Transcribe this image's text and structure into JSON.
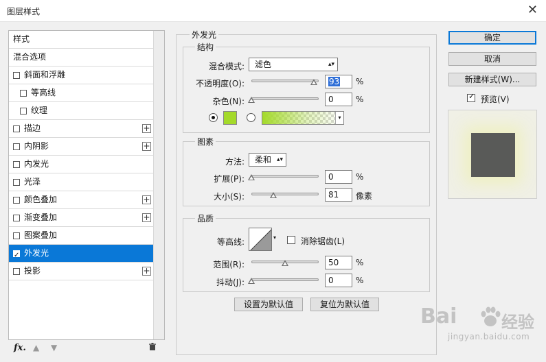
{
  "window": {
    "title": "图层样式"
  },
  "sidebar": {
    "items": [
      {
        "label": "样式",
        "kind": "head",
        "checkbox": false,
        "plus": false,
        "checked": false,
        "selected": false
      },
      {
        "label": "混合选项",
        "kind": "head",
        "checkbox": false,
        "plus": false,
        "checked": false,
        "selected": false
      },
      {
        "label": "斜面和浮雕",
        "kind": "top",
        "checkbox": true,
        "plus": false,
        "checked": false,
        "selected": false
      },
      {
        "label": "等高线",
        "kind": "sub",
        "checkbox": true,
        "plus": false,
        "checked": false,
        "selected": false
      },
      {
        "label": "纹理",
        "kind": "sub",
        "checkbox": true,
        "plus": false,
        "checked": false,
        "selected": false
      },
      {
        "label": "描边",
        "kind": "top",
        "checkbox": true,
        "plus": true,
        "checked": false,
        "selected": false
      },
      {
        "label": "内阴影",
        "kind": "top",
        "checkbox": true,
        "plus": true,
        "checked": false,
        "selected": false
      },
      {
        "label": "内发光",
        "kind": "top",
        "checkbox": true,
        "plus": false,
        "checked": false,
        "selected": false
      },
      {
        "label": "光泽",
        "kind": "top",
        "checkbox": true,
        "plus": false,
        "checked": false,
        "selected": false
      },
      {
        "label": "颜色叠加",
        "kind": "top",
        "checkbox": true,
        "plus": true,
        "checked": false,
        "selected": false
      },
      {
        "label": "渐变叠加",
        "kind": "top",
        "checkbox": true,
        "plus": true,
        "checked": false,
        "selected": false
      },
      {
        "label": "图案叠加",
        "kind": "top",
        "checkbox": true,
        "plus": false,
        "checked": false,
        "selected": false
      },
      {
        "label": "外发光",
        "kind": "top",
        "checkbox": true,
        "plus": false,
        "checked": true,
        "selected": true
      },
      {
        "label": "投影",
        "kind": "top",
        "checkbox": true,
        "plus": true,
        "checked": false,
        "selected": false
      }
    ],
    "bottom": {
      "fx": "fx",
      "fx_dot": "."
    }
  },
  "panel": {
    "title": "外发光",
    "structure": {
      "title": "结构",
      "blend_mode_label": "混合模式:",
      "blend_mode_value": "滤色",
      "opacity_label": "不透明度(O):",
      "opacity_value": "93",
      "opacity_unit": "%",
      "noise_label": "杂色(N):",
      "noise_value": "0",
      "noise_unit": "%",
      "glow_color": "#a4da2a",
      "gradient_color": "#a4da2a",
      "source": "color"
    },
    "elements": {
      "title": "图素",
      "technique_label": "方法:",
      "technique_value": "柔和",
      "spread_label": "扩展(P):",
      "spread_value": "0",
      "spread_unit": "%",
      "size_label": "大小(S):",
      "size_value": "81",
      "size_unit": "像素",
      "size_max": 250
    },
    "quality": {
      "title": "品质",
      "contour_label": "等高线:",
      "anti_alias_label": "消除锯齿(L)",
      "anti_alias_checked": false,
      "range_label": "范围(R):",
      "range_value": "50",
      "range_unit": "%",
      "jitter_label": "抖动(J):",
      "jitter_value": "0",
      "jitter_unit": "%"
    },
    "buttons": {
      "make_default": "设置为默认值",
      "reset_default": "复位为默认值"
    }
  },
  "actions": {
    "ok": "确定",
    "cancel": "取消",
    "new_style": "新建样式(W)...",
    "preview_label": "预览(V)",
    "preview_checked": true
  },
  "preview": {
    "layer_color": "#595a58",
    "glow_color": "#eef0be"
  },
  "watermark": {
    "brand_latin": "Bai",
    "brand_latin_end": "du",
    "brand_cn": "经验",
    "url": "jingyan.baidu.com"
  }
}
